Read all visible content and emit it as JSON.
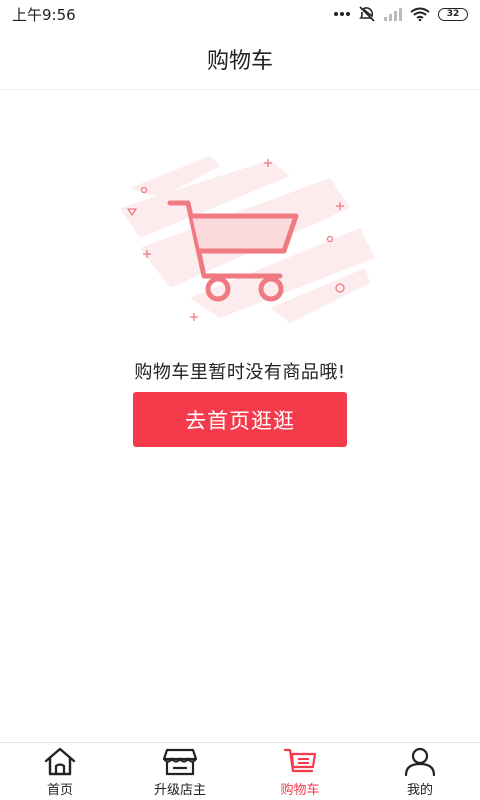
{
  "status_bar": {
    "time": "上午9:56",
    "battery": "32"
  },
  "header": {
    "title": "购物车"
  },
  "empty_state": {
    "message": "购物车里暂时没有商品哦!",
    "button_label": "去首页逛逛",
    "icon": "shopping-cart-illustration"
  },
  "tab_bar": {
    "items": [
      {
        "label": "首页",
        "icon": "home-icon",
        "active": false
      },
      {
        "label": "升级店主",
        "icon": "store-icon",
        "active": false
      },
      {
        "label": "购物车",
        "icon": "cart-icon",
        "active": true
      },
      {
        "label": "我的",
        "icon": "user-icon",
        "active": false
      }
    ]
  },
  "colors": {
    "accent": "#f53a4b",
    "cart_illustration": "#f07a82",
    "cart_bg": "#fde8ea"
  }
}
